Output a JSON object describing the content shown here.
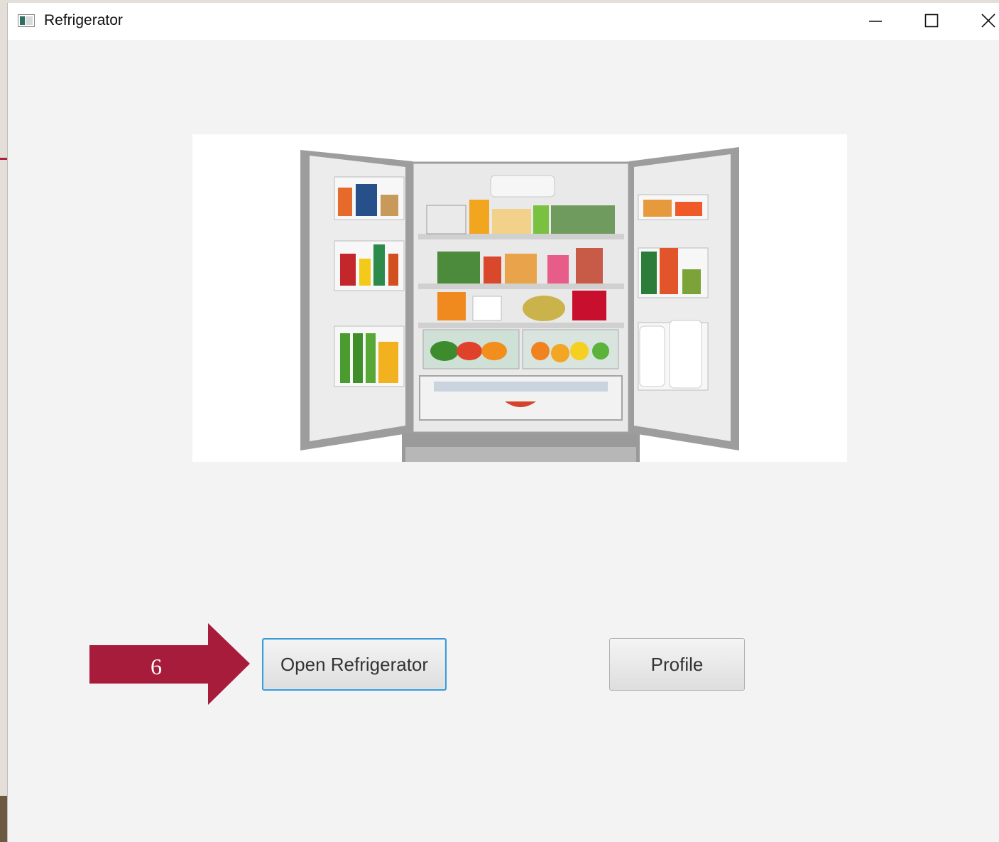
{
  "window": {
    "title": "Refrigerator",
    "app_icon": "window-app-icon",
    "controls": [
      {
        "name": "minimize",
        "icon": "minimize-icon"
      },
      {
        "name": "maximize",
        "icon": "maximize-icon"
      },
      {
        "name": "close",
        "icon": "close-icon"
      }
    ]
  },
  "content": {
    "image": "refrigerator-open-photo",
    "buttons": {
      "open_label": "Open Refrigerator",
      "profile_label": "Profile"
    }
  },
  "annotation": {
    "step_number": "6",
    "color": "#a81c3b"
  }
}
